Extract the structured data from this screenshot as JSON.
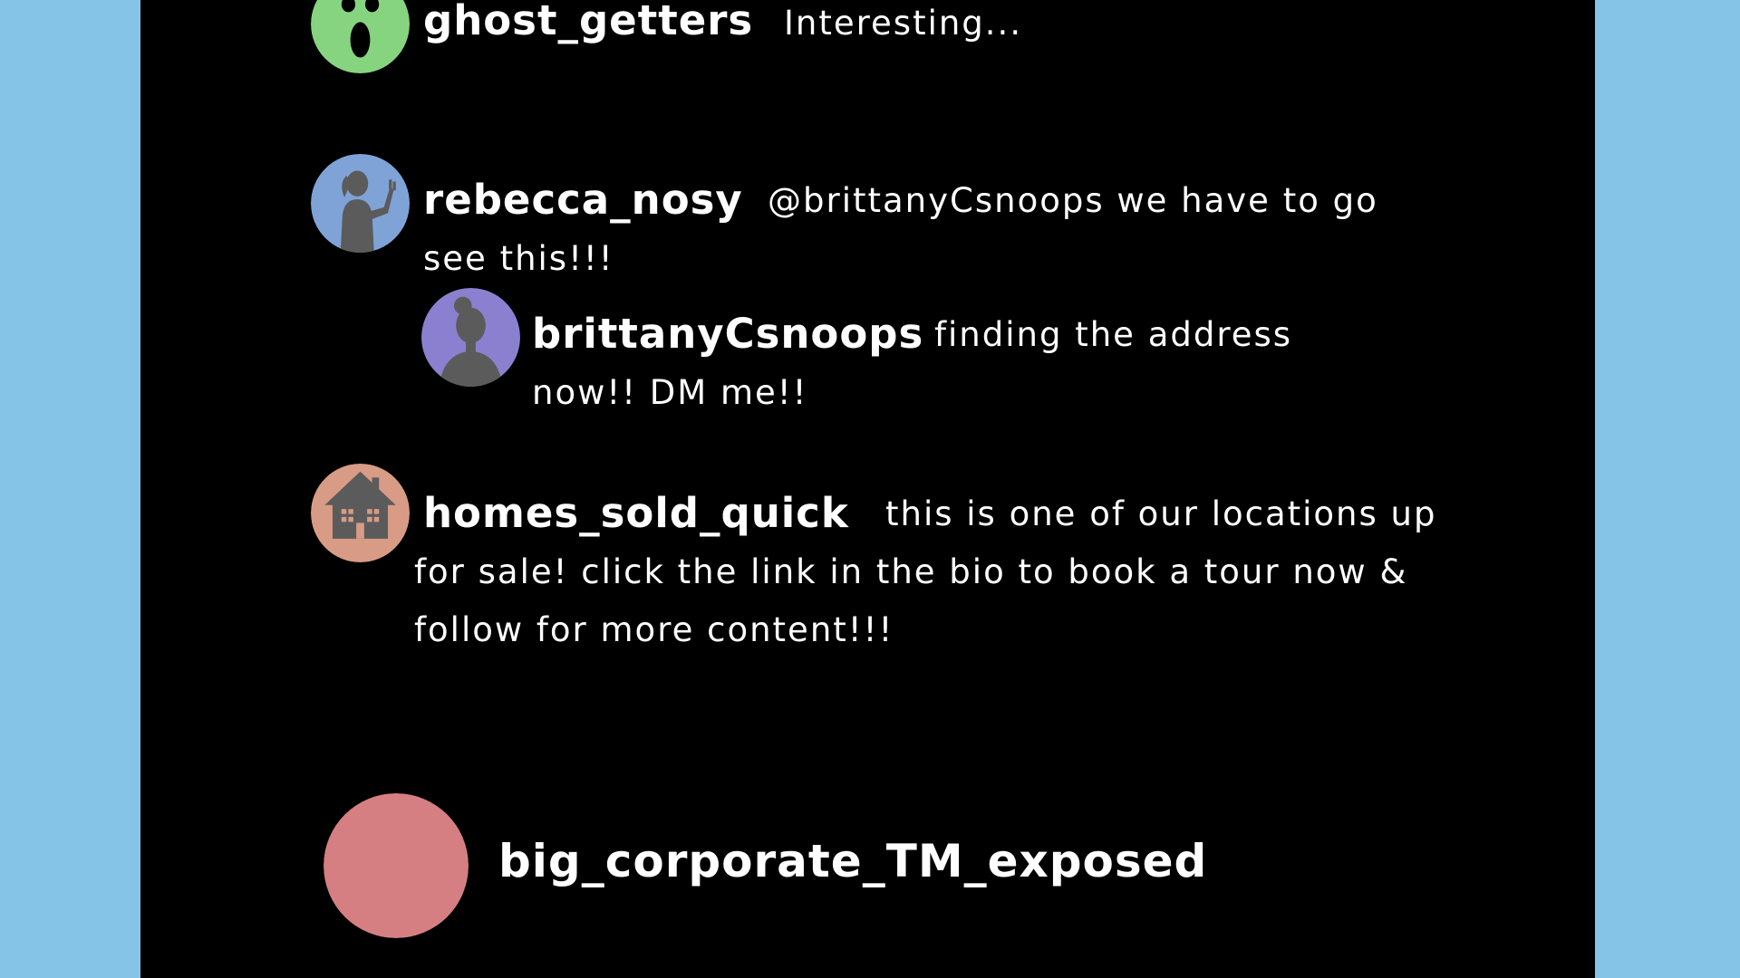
{
  "colors": {
    "page_background": "#86c4e7",
    "panel_background": "#000000",
    "text": "#ffffff",
    "avatar_ghost": "#86d47f",
    "avatar_rebecca": "#7fa3d7",
    "avatar_brittany": "#8b80cf",
    "avatar_homes": "#d89b86",
    "avatar_corporate": "#d57f83",
    "silhouette": "#5b5b5b"
  },
  "comments": [
    {
      "username": "ghost_getters",
      "avatar_icon": "ghost-face-icon",
      "lines": [
        "Interesting..."
      ]
    },
    {
      "username": "rebecca_nosy",
      "avatar_icon": "woman-waving-silhouette-icon",
      "lines": [
        "@brittanyCsnoops we have to go",
        "see this!!!"
      ]
    },
    {
      "username": "brittanyCsnoops",
      "avatar_icon": "woman-bun-silhouette-icon",
      "lines": [
        "finding the address",
        "now!! DM me!!"
      ]
    },
    {
      "username": "homes_sold_quick",
      "avatar_icon": "house-icon",
      "lines": [
        "this is one of our locations up",
        "for sale! click the link in the bio to book a tour now &",
        "follow for more content!!!"
      ]
    },
    {
      "username": "big_corporate_TM_exposed",
      "avatar_icon": "blank-avatar-icon",
      "lines": []
    }
  ]
}
